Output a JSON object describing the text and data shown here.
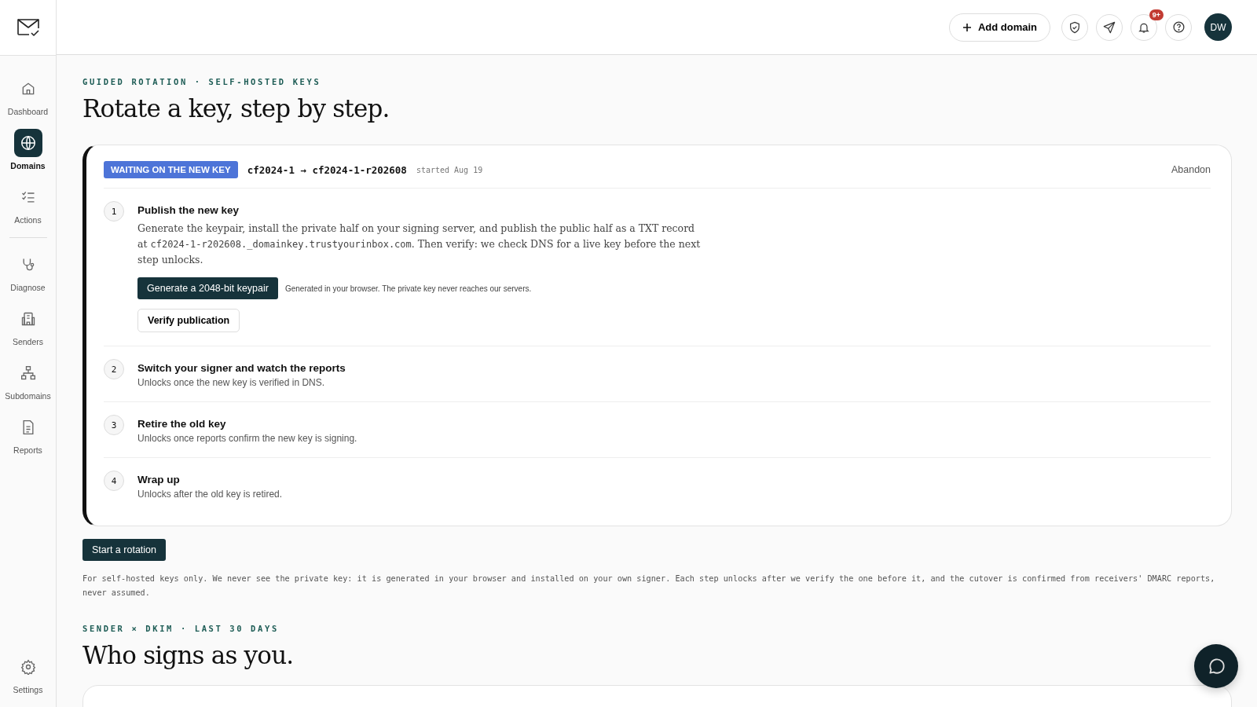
{
  "sidebar": {
    "items": [
      {
        "label": "Dashboard",
        "kind": "home",
        "selected": false
      },
      {
        "label": "Domains",
        "kind": "globe",
        "selected": true
      },
      {
        "label": "Actions",
        "kind": "checklist",
        "selected": false
      },
      {
        "label": "Diagnose",
        "kind": "stethoscope",
        "selected": false
      },
      {
        "label": "Senders",
        "kind": "building",
        "selected": false
      },
      {
        "label": "Subdomains",
        "kind": "tree",
        "selected": false
      },
      {
        "label": "Reports",
        "kind": "document",
        "selected": false
      }
    ],
    "footer": {
      "label": "Settings"
    }
  },
  "topbar": {
    "add_button": "Add domain",
    "notification_badge": "9+",
    "avatar": "DW"
  },
  "eyebrow": "GUIDED ROTATION · SELF-HOSTED KEYS",
  "title": "Rotate a key, step by step.",
  "rotation": {
    "status": "WAITING ON THE NEW KEY",
    "keys": "cf2024-1 → cf2024-1-r202608",
    "started": "started Aug 19",
    "abandon": "Abandon",
    "steps": [
      {
        "number": "1",
        "title": "Publish the new key",
        "kind": "active",
        "text_before": "Generate the keypair, install the private half on your signing server, and publish the public half as a TXT record at",
        "code": "cf2024-1-r202608._domainkey.trustyourinbox.com",
        "text_after": ". Then verify: we check DNS for a live key before the next step unlocks.",
        "primary_button": "Generate a 2048-bit keypair",
        "primary_note": "Generated in your browser. The private key never reaches our servers.",
        "secondary_button": "Verify publication"
      },
      {
        "number": "2",
        "title": "Switch your signer and watch the reports",
        "kind": "locked",
        "hint": "Unlocks once the new key is verified in DNS."
      },
      {
        "number": "3",
        "title": "Retire the old key",
        "kind": "locked",
        "hint": "Unlocks once reports confirm the new key is signing."
      },
      {
        "number": "4",
        "title": "Wrap up",
        "kind": "locked",
        "hint": "Unlocks after the old key is retired."
      }
    ]
  },
  "start_button": "Start a rotation",
  "footnote": "For self-hosted keys only. We never see the private key: it is generated in your browser and installed on your own signer. Each step unlocks after we verify the one before it, and the cutover is confirmed from receivers' DMARC reports, never assumed.",
  "section2": {
    "eyebrow": "SENDER × DKIM · LAST 30 DAYS",
    "title": "Who signs as you."
  }
}
